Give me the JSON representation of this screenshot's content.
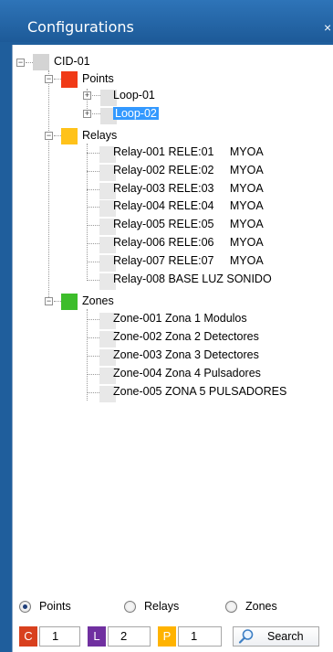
{
  "window": {
    "title": "Configurations",
    "close_glyph": "×"
  },
  "tree": {
    "root": {
      "label": "CID-01"
    },
    "points": {
      "label": "Points",
      "color": "#f03a17",
      "children": [
        {
          "label": "Loop-01"
        },
        {
          "label": "Loop-02",
          "selected": true
        }
      ]
    },
    "relays": {
      "label": "Relays",
      "color": "#ffc21a",
      "children": [
        {
          "label": "Relay-001 RELE:01     MYOA"
        },
        {
          "label": "Relay-002 RELE:02     MYOA"
        },
        {
          "label": "Relay-003 RELE:03     MYOA"
        },
        {
          "label": "Relay-004 RELE:04     MYOA"
        },
        {
          "label": "Relay-005 RELE:05     MYOA"
        },
        {
          "label": "Relay-006 RELE:06     MYOA"
        },
        {
          "label": "Relay-007 RELE:07     MYOA"
        },
        {
          "label": "Relay-008 BASE LUZ SONIDO"
        }
      ]
    },
    "zones": {
      "label": "Zones",
      "color": "#3dbd2b",
      "children": [
        {
          "label": "Zone-001 Zona 1 Modulos"
        },
        {
          "label": "Zone-002 Zona 2 Detectores"
        },
        {
          "label": "Zone-003 Zona 3 Detectores"
        },
        {
          "label": "Zone-004 Zona 4 Pulsadores"
        },
        {
          "label": "Zone-005 ZONA 5 PULSADORES"
        }
      ]
    }
  },
  "filter": {
    "options": [
      "Points",
      "Relays",
      "Zones"
    ],
    "selected": "Points"
  },
  "counters": [
    {
      "letter": "C",
      "value": "1",
      "color": "#d8401e"
    },
    {
      "letter": "L",
      "value": "2",
      "color": "#7030a0"
    },
    {
      "letter": "P",
      "value": "1",
      "color": "#ffb300"
    }
  ],
  "search": {
    "label": "Search",
    "icon": "magnifier-icon"
  }
}
